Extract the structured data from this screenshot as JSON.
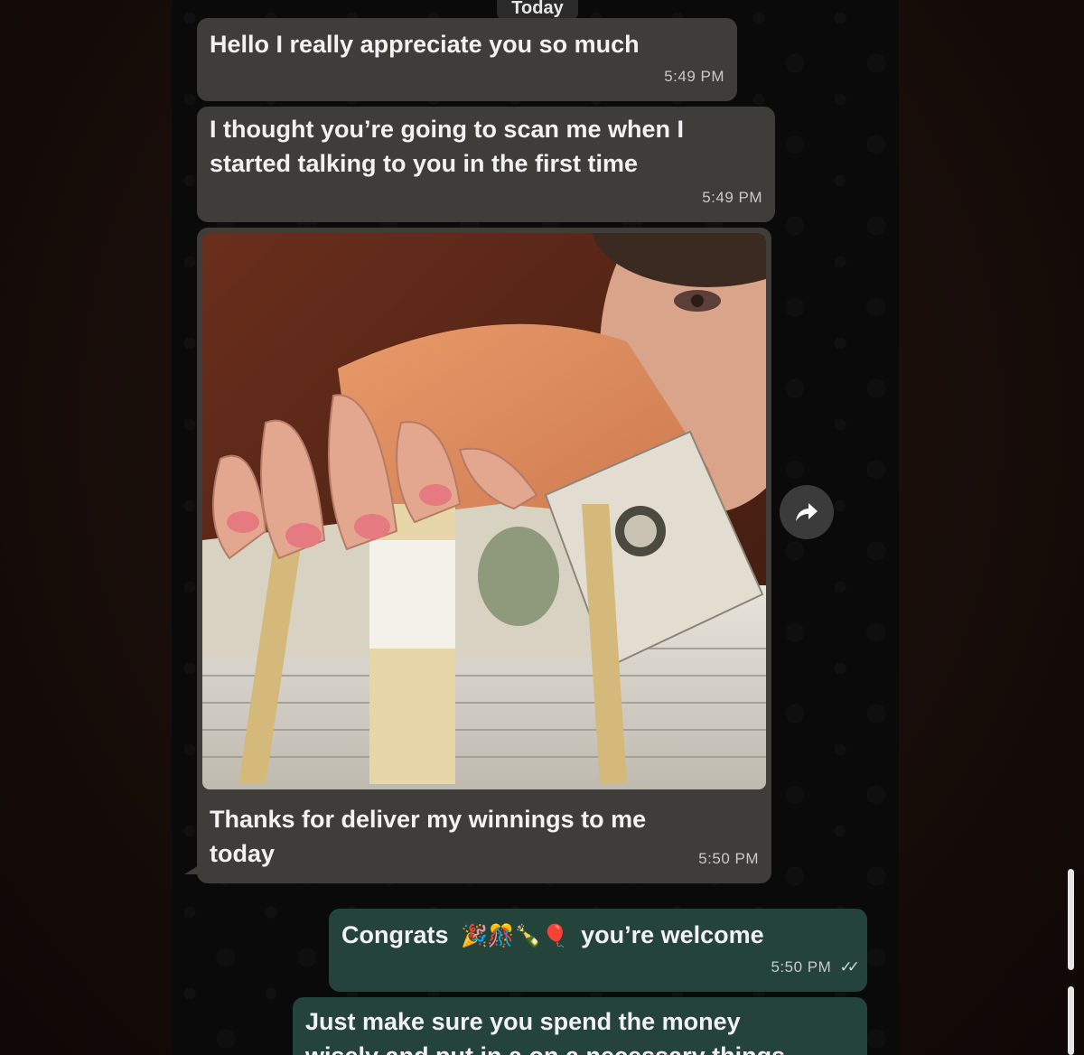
{
  "date_divider": "Today",
  "messages": [
    {
      "direction": "incoming",
      "text": "Hello I really appreciate you so much",
      "time": "5:49 PM"
    },
    {
      "direction": "incoming",
      "text_lines": [
        "I thought you’re going to scan me when I",
        "started talking to you in the first time"
      ],
      "time": "5:49 PM"
    },
    {
      "direction": "incoming",
      "has_photo": true,
      "caption_lines": [
        "Thanks for deliver my winnings to me",
        "today"
      ],
      "time": "5:50 PM"
    },
    {
      "direction": "outgoing",
      "text_before_emoji": "Congrats",
      "emoji": "🎉🎊🍾🎈",
      "text_after_emoji": "you’re welcome",
      "time": "5:50 PM"
    },
    {
      "direction": "outgoing",
      "text_lines": [
        "Just make sure you spend the money",
        "wisely and put in a on a necessary things"
      ]
    }
  ],
  "icons": {
    "forward": "forward-arrow-icon",
    "read_receipt": "double-check-icon"
  },
  "colors": {
    "incoming_bubble": "#3e3d39",
    "outgoing_bubble": "#24433a",
    "chat_background": "#0b0a0a"
  }
}
